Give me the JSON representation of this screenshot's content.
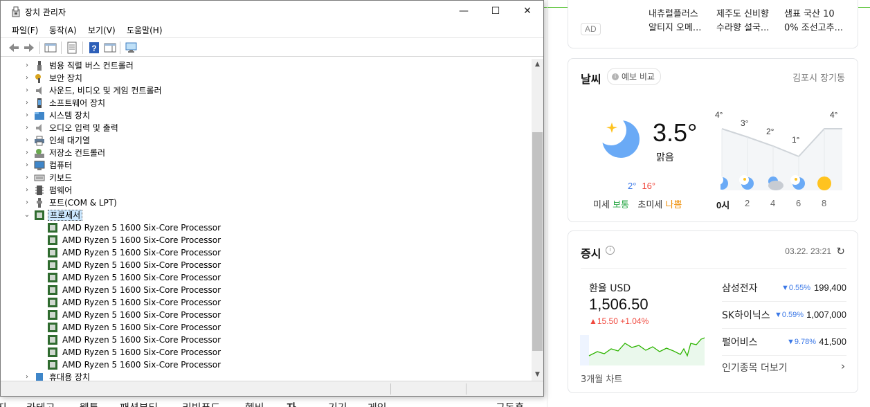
{
  "window": {
    "title": "장치 관리자",
    "controls": {
      "minimize": "—",
      "maximize": "☐",
      "close": "✕"
    }
  },
  "menu": [
    "파일(F)",
    "동작(A)",
    "보기(V)",
    "도움말(H)"
  ],
  "toolbar_icons": [
    "back-arrow-icon",
    "forward-arrow-icon",
    "show-hide-console-tree-icon",
    "properties-icon",
    "help-icon",
    "action-pane-icon",
    "scan-hardware-icon"
  ],
  "tree": {
    "categories": [
      {
        "label": "범용 직렬 버스 컨트롤러",
        "icon": "usb-icon",
        "expanded": false
      },
      {
        "label": "보안 장치",
        "icon": "security-key-icon",
        "expanded": false
      },
      {
        "label": "사운드, 비디오 및 게임 컨트롤러",
        "icon": "speaker-icon",
        "expanded": false
      },
      {
        "label": "소프트웨어 장치",
        "icon": "software-device-icon",
        "expanded": false
      },
      {
        "label": "시스템 장치",
        "icon": "system-folder-icon",
        "expanded": false
      },
      {
        "label": "오디오 입력 및 출력",
        "icon": "audio-icon",
        "expanded": false
      },
      {
        "label": "인쇄 대기열",
        "icon": "printer-icon",
        "expanded": false
      },
      {
        "label": "저장소 컨트롤러",
        "icon": "storage-controller-icon",
        "expanded": false
      },
      {
        "label": "컴퓨터",
        "icon": "computer-icon",
        "expanded": false
      },
      {
        "label": "키보드",
        "icon": "keyboard-icon",
        "expanded": false
      },
      {
        "label": "펌웨어",
        "icon": "firmware-icon",
        "expanded": false
      },
      {
        "label": "포트(COM & LPT)",
        "icon": "port-icon",
        "expanded": false
      },
      {
        "label": "프로세서",
        "icon": "processor-icon",
        "expanded": true,
        "selected": true
      }
    ],
    "processors": [
      "AMD Ryzen 5 1600 Six-Core Processor",
      "AMD Ryzen 5 1600 Six-Core Processor",
      "AMD Ryzen 5 1600 Six-Core Processor",
      "AMD Ryzen 5 1600 Six-Core Processor",
      "AMD Ryzen 5 1600 Six-Core Processor",
      "AMD Ryzen 5 1600 Six-Core Processor",
      "AMD Ryzen 5 1600 Six-Core Processor",
      "AMD Ryzen 5 1600 Six-Core Processor",
      "AMD Ryzen 5 1600 Six-Core Processor",
      "AMD Ryzen 5 1600 Six-Core Processor",
      "AMD Ryzen 5 1600 Six-Core Processor",
      "AMD Ryzen 5 1600 Six-Core Processor"
    ],
    "after": [
      {
        "label": "휴대용 장치",
        "icon": "portable-device-icon",
        "expanded": false
      }
    ]
  },
  "background": {
    "left_strip_text": [
      "구",
      "트",
      "으",
      "1"
    ],
    "nav_items": [
      "지",
      "카테고",
      "웹툰",
      "패션뷰티",
      "리빙푸드",
      "헬비",
      "자",
      "기기",
      "게임",
      "구독홍"
    ],
    "ad": {
      "badge": "AD",
      "items": [
        {
          "line1": "내츄럴플러스",
          "line2": "알티지 오메..."
        },
        {
          "line1": "제주도 신비향",
          "line2": "수라향 설국..."
        },
        {
          "line1": "샘표 국산 10",
          "line2": "0% 조선고추..."
        }
      ]
    },
    "weather": {
      "title": "날씨",
      "compare": "예보 비교",
      "compare_icon": "info-dot-icon",
      "location": "김포시 장기동",
      "temp": "3.5°",
      "condition": "맑음",
      "low": "2°",
      "high": "16°",
      "dust_label": "미세",
      "dust_value": "보통",
      "fine_dust_label": "초미세",
      "fine_dust_value": "나쁨",
      "hourly": [
        {
          "hour": "0시",
          "temp": "4°",
          "icon": "moon-icon"
        },
        {
          "hour": "2",
          "temp": "3°",
          "icon": "moon-icon"
        },
        {
          "hour": "4",
          "temp": "2°",
          "icon": "moon-cloud-icon"
        },
        {
          "hour": "6",
          "temp": "1°",
          "icon": "moon-icon"
        },
        {
          "hour": "8",
          "temp": "4°",
          "icon": "sun-icon"
        }
      ]
    },
    "stocks": {
      "title": "증시",
      "time": "03.22. 23:21",
      "fx_label": "환율 USD",
      "fx_value": "1,506.50",
      "fx_change": "▲15.50  +1.04%",
      "fx_period": "3개월 차트",
      "items": [
        {
          "name": "삼성전자",
          "pct": "▼0.55%",
          "price": "199,400"
        },
        {
          "name": "SK하이닉스",
          "pct": "▼0.59%",
          "price": "1,007,000"
        },
        {
          "name": "펄어비스",
          "pct": "▼9.78%",
          "price": "41,500"
        }
      ],
      "more": "인기종목 더보기"
    },
    "colors": {
      "accent_green": "#2db400",
      "up_red": "#f0493e",
      "down_blue": "#3b78e7",
      "moon_blue": "#6aaaf6",
      "sun_yellow": "#ffc31f"
    }
  }
}
